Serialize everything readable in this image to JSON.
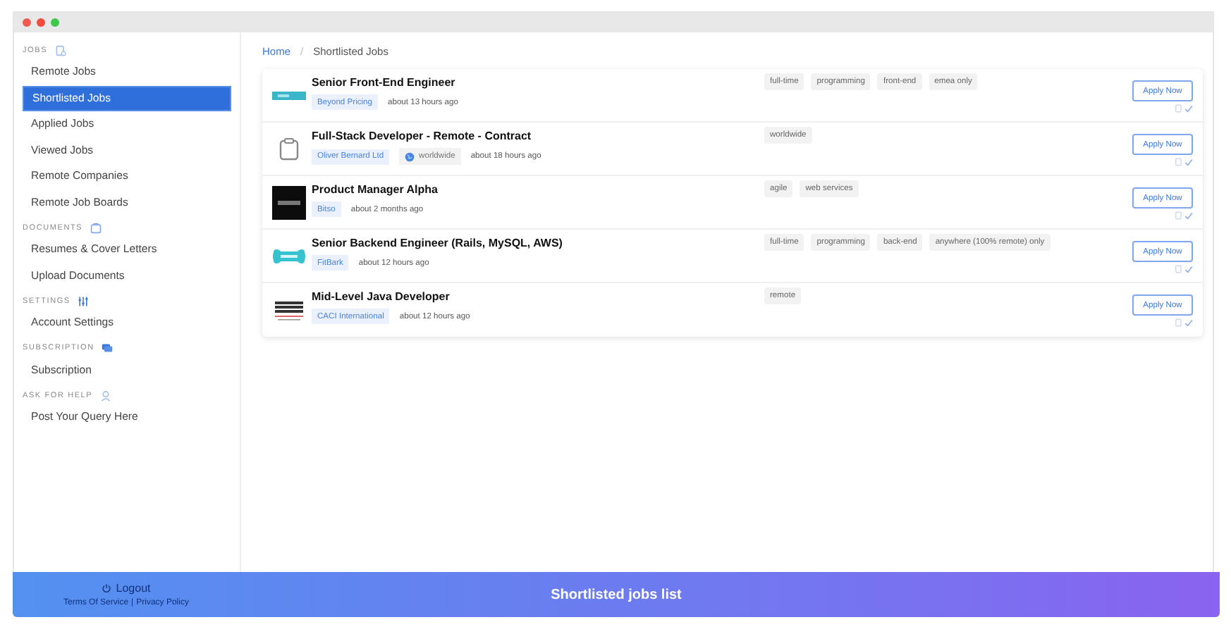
{
  "sidebar": {
    "sections": [
      {
        "heading": "JOBS",
        "items": [
          {
            "label": "Remote Jobs",
            "selected": false
          },
          {
            "label": "Shortlisted Jobs",
            "selected": true
          },
          {
            "label": "Applied Jobs",
            "selected": false
          },
          {
            "label": "Viewed Jobs",
            "selected": false
          },
          {
            "label": "Remote Companies",
            "selected": false
          },
          {
            "label": "Remote Job Boards",
            "selected": false
          }
        ]
      },
      {
        "heading": "DOCUMENTS",
        "items": [
          {
            "label": "Resumes & Cover Letters",
            "selected": false
          },
          {
            "label": "Upload Documents",
            "selected": false
          }
        ]
      },
      {
        "heading": "SETTINGS",
        "items": [
          {
            "label": "Account Settings",
            "selected": false
          }
        ]
      },
      {
        "heading": "SUBSCRIPTION",
        "items": [
          {
            "label": "Subscription",
            "selected": false
          }
        ]
      },
      {
        "heading": "ASK FOR HELP",
        "items": [
          {
            "label": "Post Your Query Here",
            "selected": false
          }
        ]
      }
    ],
    "logout": "Logout",
    "footer_links": [
      "Terms Of Service",
      "Privacy Policy"
    ],
    "footer_separator": "|"
  },
  "breadcrumb": {
    "items": [
      "Home",
      "Shortlisted Jobs"
    ],
    "separator": "/"
  },
  "jobs": [
    {
      "kind": "bar",
      "title": "Senior Front-End Engineer",
      "company": "Beyond Pricing",
      "posted": "about 13 hours ago",
      "tags": [
        "full-time",
        "programming",
        "front-end",
        "emea only"
      ],
      "button": "Apply Now"
    },
    {
      "kind": "clipboard",
      "title": "Full-Stack Developer - Remote - Contract",
      "company": "Oliver Bernard Ltd",
      "location": "worldwide",
      "posted": "about 18 hours ago",
      "tags": [
        "worldwide"
      ],
      "button": "Apply Now"
    },
    {
      "kind": "dark",
      "title": "Product Manager Alpha",
      "company": "Bitso",
      "posted": "about 2 months ago",
      "tags": [
        "agile",
        "web services"
      ],
      "button": "Apply Now"
    },
    {
      "kind": "bone",
      "title": "Senior Backend Engineer (Rails, MySQL, AWS)",
      "company": "FitBark",
      "posted": "about 12 hours ago",
      "tags": [
        "full-time",
        "programming",
        "back-end",
        "anywhere (100% remote) only"
      ],
      "button": "Apply Now"
    },
    {
      "kind": "lines",
      "title": "Mid-Level Java Developer",
      "company": "CACI International",
      "posted": "about 12 hours ago",
      "tags": [
        "remote"
      ],
      "button": "Apply Now"
    }
  ],
  "caption": "Shortlisted jobs list"
}
